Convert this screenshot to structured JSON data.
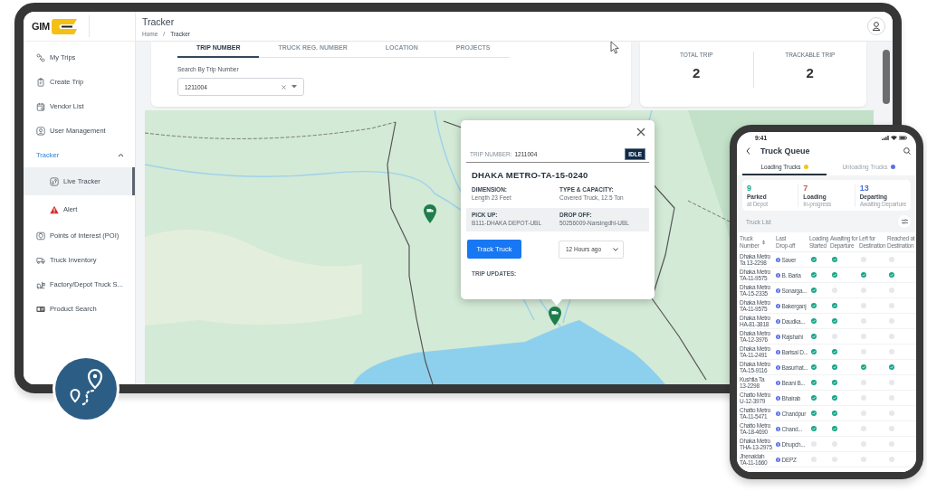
{
  "logo": {
    "text": "GIM"
  },
  "sidebar": {
    "items": [
      {
        "label": "My Trips",
        "selected": false
      },
      {
        "label": "Create Trip",
        "selected": false
      },
      {
        "label": "Vendor List",
        "selected": false
      },
      {
        "label": "User Management",
        "selected": false
      },
      {
        "label": "Tracker",
        "selected": false,
        "expanded": true,
        "children": [
          {
            "label": "Live Tracker",
            "selected": true
          },
          {
            "label": "Alert",
            "selected": false
          }
        ]
      },
      {
        "label": "Points of Interest (POI)",
        "selected": false
      },
      {
        "label": "Truck Inventory",
        "selected": false
      },
      {
        "label": "Factory/Depot Truck S...",
        "selected": false
      },
      {
        "label": "Product Search",
        "selected": false
      }
    ]
  },
  "header": {
    "title": "Tracker",
    "breadcrumb": [
      "Home",
      "Tracker"
    ],
    "separator": "/"
  },
  "search_tabs": [
    {
      "label": "TRIP NUMBER",
      "selected": true
    },
    {
      "label": "TRUCK REG. NUMBER",
      "selected": false
    },
    {
      "label": "LOCATION",
      "selected": false
    },
    {
      "label": "PROJECTS",
      "selected": false
    }
  ],
  "search": {
    "label": "Search By Trip Number",
    "value": "1211004"
  },
  "stats": [
    {
      "label": "TOTAL TRIP",
      "value": "2"
    },
    {
      "label": "TRACKABLE TRIP",
      "value": "2"
    }
  ],
  "map": {
    "popup": {
      "trip_label": "TRIP NUMBER:",
      "trip_number": "1211004",
      "status": "IDLE",
      "vehicle": "DHAKA METRO-TA-15-0240",
      "details": [
        {
          "cells": [
            {
              "label": "DIMENSION:",
              "value": "Length 23 Feet"
            },
            {
              "label": "TYPE & CAPACITY:",
              "value": "Covered Truck, 12.5 Ton"
            }
          ]
        },
        {
          "cells": [
            {
              "label": "PICK UP:",
              "value": "B111-DHAKA DEPOT-UBL"
            },
            {
              "label": "DROP OFF:",
              "value": "50256009-Narsingdhi-UBL"
            }
          ]
        }
      ],
      "button": "Track Truck",
      "time_filter": "12 Hours ago",
      "updates_label": "TRIP UPDATES:"
    }
  },
  "phone": {
    "time": "9:41",
    "title": "Truck Queue",
    "tabs": [
      {
        "label": "Loading Trucks",
        "selected": true,
        "color": "#f5c518"
      },
      {
        "label": "Unloading Trucks",
        "selected": false,
        "color": "#5b6ee8"
      }
    ],
    "summary": [
      {
        "value": "9",
        "label": "Parked",
        "sublabel": "at Depot",
        "color": "#1aa58a"
      },
      {
        "value": "7",
        "label": "Loading",
        "sublabel": "In-progress",
        "color": "#d9534f"
      },
      {
        "value": "13",
        "label": "Departing",
        "sublabel": "Awaiting Departure",
        "color": "#4a6cd4"
      }
    ],
    "list_label": "Truck List",
    "columns": [
      "Truck Number",
      "Last Drop-off",
      "Loading Started",
      "Awaiting for Departure",
      "Left for Destination",
      "Reached at Destination"
    ],
    "rows": [
      {
        "truck": "Dhaka Metro Ta 13-2298",
        "drop_off": "Saver",
        "steps": [
          true,
          true,
          false,
          false
        ]
      },
      {
        "truck": "Dhaka Metro TA-11-9575",
        "drop_off": "B. Baria",
        "steps": [
          true,
          true,
          true,
          true
        ]
      },
      {
        "truck": "Dhaka Metro TA-15-2335",
        "drop_off": "Sonarga...",
        "steps": [
          true,
          false,
          false,
          false
        ]
      },
      {
        "truck": "Dhaka Metro TA-11-9575",
        "drop_off": "Bakerganj",
        "steps": [
          true,
          true,
          false,
          false
        ]
      },
      {
        "truck": "Dhaka Metro HA-81-3818",
        "drop_off": "Daudka...",
        "steps": [
          true,
          true,
          false,
          false
        ]
      },
      {
        "truck": "Dhaka Metro TA-12-3976",
        "drop_off": "Rajshahi",
        "steps": [
          true,
          false,
          false,
          false
        ]
      },
      {
        "truck": "Dhaka Metro TA-11-2491",
        "drop_off": "Barisal D...",
        "steps": [
          true,
          true,
          false,
          false
        ]
      },
      {
        "truck": "Dhaka Metro TA-15-9116",
        "drop_off": "Basurhat...",
        "steps": [
          true,
          true,
          true,
          true
        ]
      },
      {
        "truck": "Kushtia Ta 13-2298",
        "drop_off": "Beani B...",
        "steps": [
          true,
          true,
          false,
          false
        ]
      },
      {
        "truck": "Chatto Metro U-12-3979",
        "drop_off": "Bhairab",
        "steps": [
          true,
          true,
          false,
          false
        ]
      },
      {
        "truck": "Chatto Metro TA-11-5471",
        "drop_off": "Chandpur",
        "steps": [
          true,
          true,
          false,
          false
        ]
      },
      {
        "truck": "Chatto Metro TA-18-4690",
        "drop_off": "Chand...",
        "steps": [
          true,
          true,
          false,
          false
        ]
      },
      {
        "truck": "Dhaka Metro THA-13-2975",
        "drop_off": "Dhupch...",
        "steps": [
          false,
          false,
          false,
          false
        ]
      },
      {
        "truck": "Jhenaidah TA-11-1660",
        "drop_off": "DEPZ",
        "steps": [
          false,
          false,
          false,
          false
        ]
      }
    ]
  }
}
